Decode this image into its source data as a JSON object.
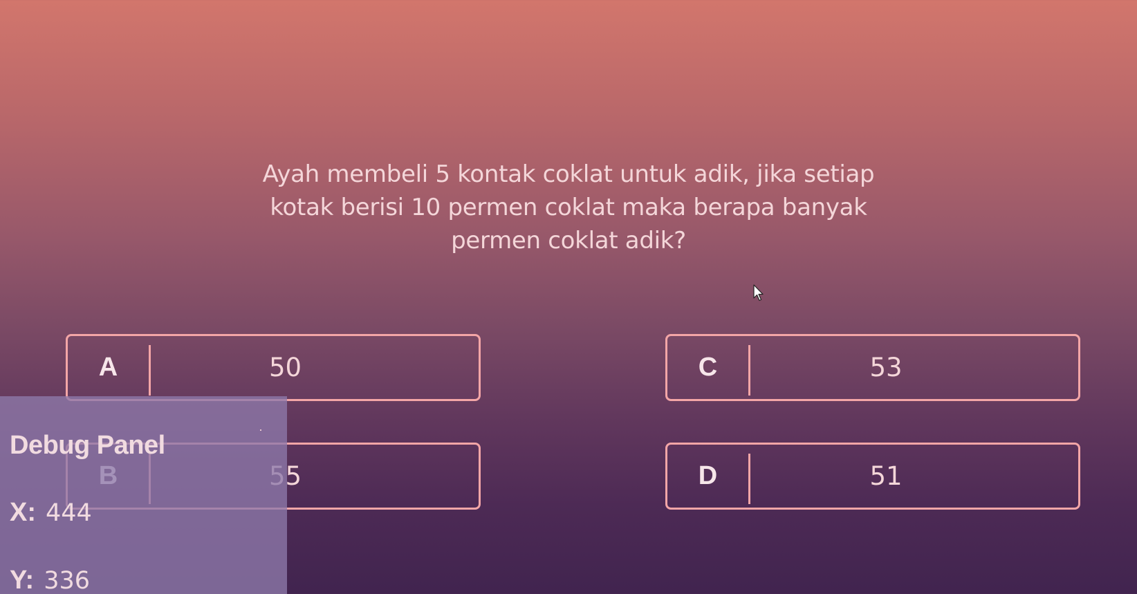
{
  "question": {
    "line1": "Ayah membeli 5 kontak coklat untuk adik, jika setiap",
    "line2": "kotak berisi 10 permen coklat maka berapa banyak",
    "line3": "permen coklat adik?"
  },
  "options": {
    "a": {
      "letter": "A",
      "value": "50"
    },
    "b": {
      "letter": "B",
      "value": "55"
    },
    "c": {
      "letter": "C",
      "value": "53"
    },
    "d": {
      "letter": "D",
      "value": "51"
    }
  },
  "debug": {
    "title": "Debug Panel",
    "x_label": "X:",
    "x_value": "444",
    "y_label": "Y:",
    "y_value": "336"
  },
  "colors": {
    "gradient_top": "#d2766c",
    "gradient_bottom": "#41244f",
    "option_border": "#f4a6a7",
    "text": "#f4d6d9",
    "debug_panel": "#8e7aaa"
  }
}
